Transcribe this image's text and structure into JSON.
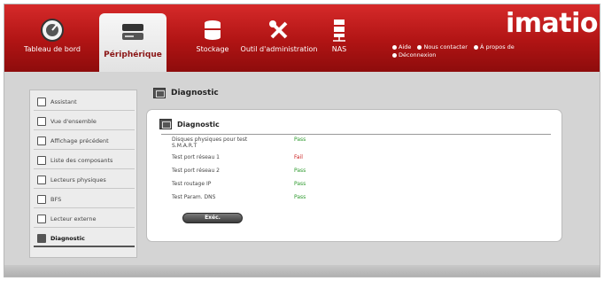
{
  "header": {
    "logo": "imation",
    "tabs": [
      {
        "label": "Tableau de bord",
        "icon": "dashboard-gauge-icon"
      },
      {
        "label": "Périphérique",
        "icon": "device-drive-icon",
        "active": true
      },
      {
        "label": "Stockage",
        "icon": "storage-stack-icon"
      },
      {
        "label": "Outil d'administration",
        "icon": "tools-icon"
      },
      {
        "label": "NAS",
        "icon": "nas-server-icon"
      }
    ],
    "links": [
      {
        "label": "Aide",
        "icon": "help-icon"
      },
      {
        "label": "Nous contacter",
        "icon": "contact-icon"
      },
      {
        "label": "À propos de",
        "icon": "about-icon"
      },
      {
        "label": "Déconnexion",
        "icon": "logout-icon"
      }
    ]
  },
  "sidebar": {
    "items": [
      {
        "label": "Assistant",
        "icon": "wand-icon"
      },
      {
        "label": "Vue d'ensemble",
        "icon": "overview-icon"
      },
      {
        "label": "Affichage précédent",
        "icon": "previous-view-icon"
      },
      {
        "label": "Liste des composants",
        "icon": "component-list-icon"
      },
      {
        "label": "Lecteurs physiques",
        "icon": "physical-drive-icon"
      },
      {
        "label": "BFS",
        "icon": "bfs-icon"
      },
      {
        "label": "Lecteur externe",
        "icon": "external-drive-icon"
      },
      {
        "label": "Diagnostic",
        "icon": "diagnostic-icon",
        "active": true
      }
    ]
  },
  "main": {
    "title": "Diagnostic",
    "panel": {
      "title": "Diagnostic",
      "rows": [
        {
          "label": "Disques physiques pour test S.M.A.R.T",
          "status": "Pass",
          "state": "pass"
        },
        {
          "label": "Test port réseau 1",
          "status": "Fail",
          "state": "fail"
        },
        {
          "label": "Test port réseau 2",
          "status": "Pass",
          "state": "pass"
        },
        {
          "label": "Test routage IP",
          "status": "Pass",
          "state": "pass"
        },
        {
          "label": "Test Param. DNS",
          "status": "Pass",
          "state": "pass"
        }
      ],
      "run_button": "Exéc."
    }
  },
  "colors": {
    "header_red": "#b01414",
    "pass_green": "#2e9a2e",
    "fail_red": "#cc2020"
  }
}
